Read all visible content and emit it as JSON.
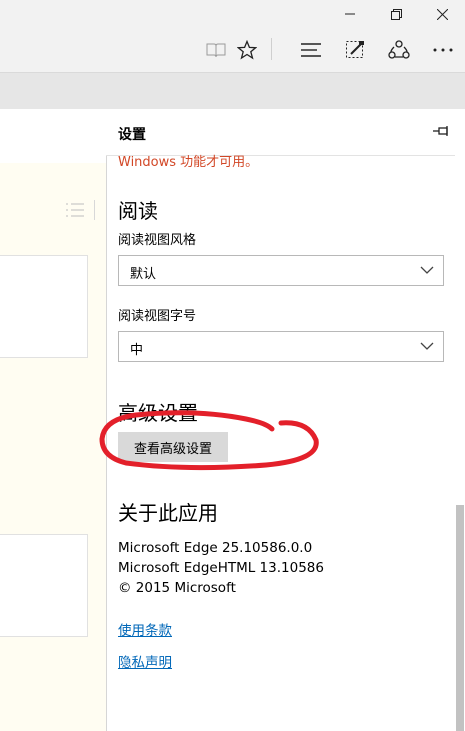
{
  "window": {
    "minimize_icon": "minimize-icon",
    "restore_icon": "restore-icon",
    "close_icon": "close-icon"
  },
  "toolbar": {
    "icons": [
      "reading-view-icon",
      "favorite-star-icon",
      "hub-icon",
      "web-note-icon",
      "share-icon",
      "more-icon"
    ]
  },
  "settings": {
    "title": "设置",
    "warning_text": "Windows 功能才可用。",
    "reading": {
      "heading": "阅读",
      "style_label": "阅读视图风格",
      "style_value": "默认",
      "font_label": "阅读视图字号",
      "font_value": "中"
    },
    "advanced": {
      "heading": "高级设置",
      "button_label": "查看高级设置"
    },
    "about": {
      "heading": "关于此应用",
      "version_line1": "Microsoft Edge 25.10586.0.0",
      "version_line2": "Microsoft EdgeHTML 13.10586",
      "copyright": "© 2015 Microsoft",
      "terms_link": "使用条款",
      "privacy_link": "隐私声明"
    }
  },
  "colors": {
    "warning": "#d24726",
    "link": "#0067b8",
    "annotation": "#e3202a"
  }
}
